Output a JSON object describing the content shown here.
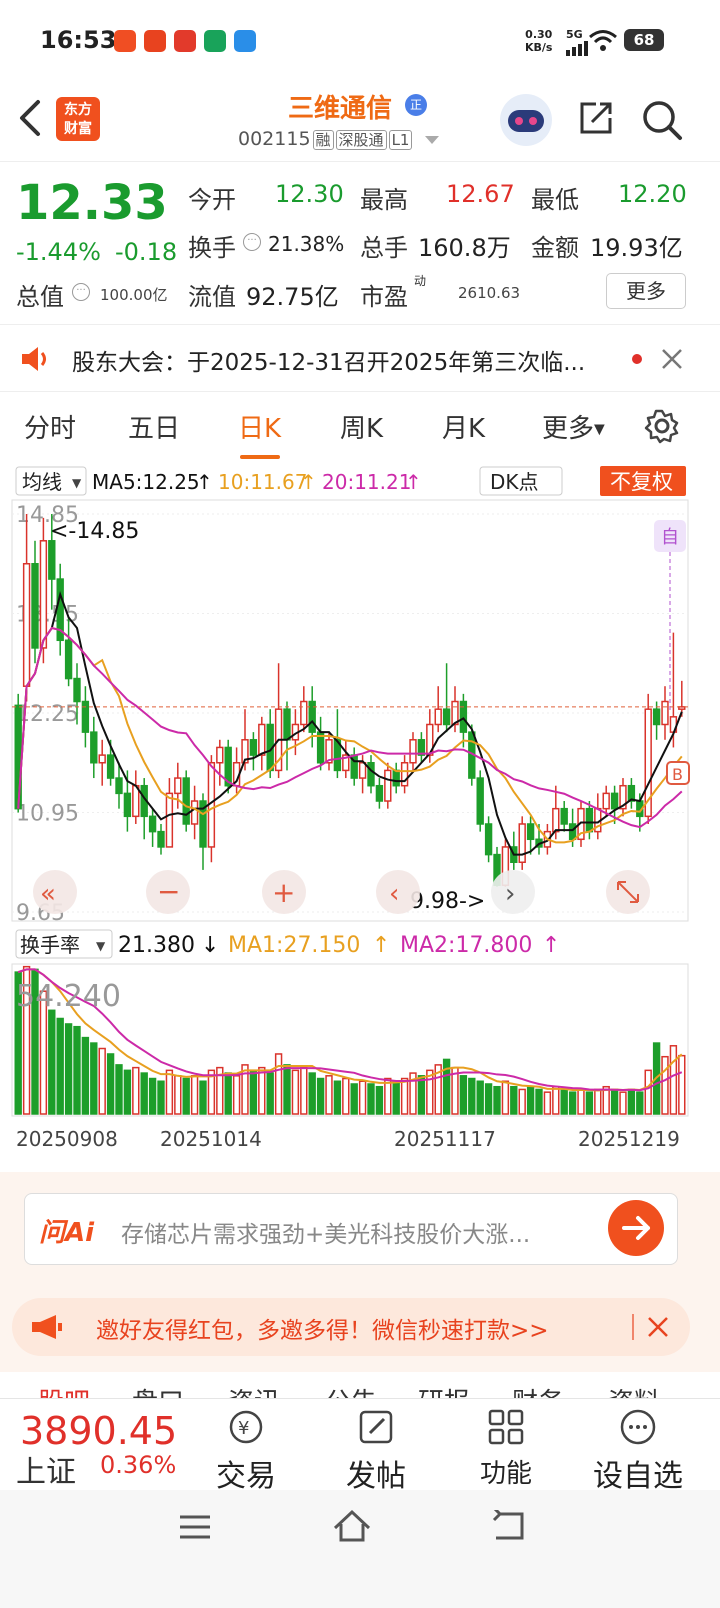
{
  "status": {
    "time": "16:53",
    "net_speed_value": "0.30",
    "net_speed_unit": "KB/s",
    "signal": "5G",
    "battery": "68",
    "app_badges": [
      "#f04e23",
      "#e8431f",
      "#e23a2b",
      "#19a35a",
      "#2a8ee8"
    ]
  },
  "header": {
    "logo_line1": "东方",
    "logo_line2": "财富",
    "stock_name": "三维通信",
    "zheng": "正",
    "code": "002115",
    "tag_rong": "融",
    "tag_sgt": "深股通",
    "tag_l1": "L1"
  },
  "quote": {
    "price": "12.33",
    "change_pct": "-1.44%",
    "change": "-0.18",
    "open_label": "今开",
    "open": "12.30",
    "high_label": "最高",
    "high": "12.67",
    "low_label": "最低",
    "low": "12.20",
    "turnover_label": "换手",
    "turnover": "21.38%",
    "volume_label": "总手",
    "volume": "160.8万",
    "amount_label": "金额",
    "amount": "19.93亿",
    "mktcap_label": "总值",
    "mktcap": "100.00亿",
    "float_label": "流值",
    "float": "92.75亿",
    "pe_label": "市盈",
    "pe_sup": "动",
    "pe": "2610.63",
    "more": "更多"
  },
  "notice": {
    "text": "股东大会：于2025-12-31召开2025年第三次临..."
  },
  "tabs": {
    "items": [
      "分时",
      "五日",
      "日K",
      "周K",
      "月K",
      "更多"
    ],
    "active": 2
  },
  "chart_data": {
    "type": "candlestick",
    "indicator_label": "均线",
    "ma5": "MA5:12.25",
    "ma10": "10:11.67",
    "ma20": "20:11.21",
    "dk_label": "DK点",
    "fq_label": "不复权",
    "y_ticks": [
      "14.85",
      "13.55",
      "12.25",
      "10.95",
      "9.65"
    ],
    "ylim": [
      9.65,
      14.85
    ],
    "high_marker": "<-14.85",
    "low_marker": "9.98->",
    "zi_marker": "自",
    "b_marker": "B",
    "colors": {
      "up": "#d9332b",
      "down": "#1d9e2a",
      "ma5": "#111111",
      "ma10": "#e8a020",
      "ma20": "#cc2aa8",
      "turnover": "#1d9e2a"
    },
    "candles": [
      [
        12.35,
        11.0,
        12.5,
        10.95
      ],
      [
        12.6,
        14.2,
        14.85,
        12.4
      ],
      [
        14.2,
        13.1,
        14.5,
        12.9
      ],
      [
        13.1,
        14.5,
        14.8,
        12.9
      ],
      [
        14.5,
        14.0,
        14.85,
        13.6
      ],
      [
        14.0,
        13.2,
        14.2,
        13.0
      ],
      [
        13.2,
        12.7,
        13.5,
        12.6
      ],
      [
        12.7,
        12.4,
        12.9,
        12.1
      ],
      [
        12.4,
        12.0,
        12.6,
        11.8
      ],
      [
        12.0,
        11.6,
        12.2,
        11.4
      ],
      [
        11.6,
        11.7,
        11.9,
        11.3
      ],
      [
        11.7,
        11.4,
        11.9,
        11.3
      ],
      [
        11.4,
        11.2,
        11.6,
        11.0
      ],
      [
        11.2,
        10.9,
        11.5,
        10.7
      ],
      [
        10.9,
        11.3,
        11.5,
        10.8
      ],
      [
        11.3,
        10.9,
        11.4,
        10.6
      ],
      [
        10.9,
        10.7,
        11.0,
        10.5
      ],
      [
        10.7,
        10.5,
        10.8,
        10.4
      ],
      [
        10.5,
        11.2,
        11.4,
        10.5
      ],
      [
        11.2,
        11.4,
        11.6,
        11.0
      ],
      [
        11.4,
        10.8,
        11.5,
        10.7
      ],
      [
        10.8,
        11.1,
        11.3,
        10.6
      ],
      [
        11.1,
        10.5,
        11.2,
        10.2
      ],
      [
        10.5,
        11.6,
        11.7,
        10.3
      ],
      [
        11.6,
        11.8,
        11.9,
        11.3
      ],
      [
        11.8,
        11.3,
        11.9,
        11.2
      ],
      [
        11.3,
        11.6,
        11.8,
        11.2
      ],
      [
        11.6,
        11.9,
        12.3,
        11.5
      ],
      [
        11.9,
        11.7,
        12.0,
        11.5
      ],
      [
        11.7,
        12.1,
        12.2,
        11.5
      ],
      [
        12.1,
        11.5,
        12.3,
        11.4
      ],
      [
        11.5,
        12.3,
        12.9,
        11.4
      ],
      [
        12.3,
        11.9,
        12.4,
        11.5
      ],
      [
        11.9,
        12.1,
        12.3,
        11.7
      ],
      [
        12.1,
        12.4,
        12.6,
        12.0
      ],
      [
        12.4,
        12.0,
        12.6,
        11.8
      ],
      [
        12.0,
        11.6,
        12.2,
        11.5
      ],
      [
        11.6,
        11.9,
        12.0,
        11.5
      ],
      [
        11.9,
        11.5,
        12.3,
        11.4
      ],
      [
        11.5,
        11.7,
        11.9,
        11.4
      ],
      [
        11.7,
        11.4,
        11.8,
        11.3
      ],
      [
        11.4,
        11.6,
        11.7,
        11.2
      ],
      [
        11.6,
        11.3,
        11.7,
        11.2
      ],
      [
        11.3,
        11.1,
        11.4,
        11.0
      ],
      [
        11.1,
        11.5,
        11.6,
        11.0
      ],
      [
        11.5,
        11.3,
        11.6,
        11.2
      ],
      [
        11.3,
        11.6,
        11.7,
        11.2
      ],
      [
        11.6,
        11.9,
        12.0,
        11.5
      ],
      [
        11.9,
        11.7,
        12.0,
        11.6
      ],
      [
        11.7,
        12.1,
        12.3,
        11.6
      ],
      [
        12.1,
        12.3,
        12.6,
        12.0
      ],
      [
        12.3,
        12.1,
        12.9,
        12.0
      ],
      [
        12.1,
        12.4,
        12.6,
        12.0
      ],
      [
        12.4,
        12.0,
        12.5,
        11.8
      ],
      [
        12.0,
        11.4,
        12.1,
        11.3
      ],
      [
        11.4,
        10.8,
        11.5,
        10.7
      ],
      [
        10.8,
        10.4,
        10.9,
        10.3
      ],
      [
        10.4,
        10.0,
        10.5,
        9.98
      ],
      [
        10.0,
        10.5,
        10.6,
        9.98
      ],
      [
        10.5,
        10.3,
        10.7,
        10.2
      ],
      [
        10.3,
        10.8,
        10.9,
        10.2
      ],
      [
        10.8,
        10.6,
        10.9,
        10.4
      ],
      [
        10.6,
        10.5,
        10.8,
        10.4
      ],
      [
        10.5,
        10.7,
        10.8,
        10.4
      ],
      [
        10.7,
        11.0,
        11.3,
        10.6
      ],
      [
        11.0,
        10.8,
        11.1,
        10.7
      ],
      [
        10.8,
        10.6,
        11.0,
        10.5
      ],
      [
        10.6,
        11.0,
        11.1,
        10.5
      ],
      [
        11.0,
        10.7,
        11.1,
        10.6
      ],
      [
        10.7,
        11.0,
        11.2,
        10.6
      ],
      [
        11.0,
        11.2,
        11.3,
        10.9
      ],
      [
        11.2,
        11.0,
        11.3,
        10.8
      ],
      [
        11.0,
        11.3,
        11.4,
        10.9
      ],
      [
        11.3,
        11.1,
        11.4,
        11.0
      ],
      [
        11.1,
        10.9,
        11.2,
        10.7
      ],
      [
        10.9,
        12.3,
        12.5,
        10.8
      ],
      [
        12.3,
        12.1,
        12.4,
        11.9
      ],
      [
        12.1,
        12.4,
        12.6,
        11.9
      ],
      [
        12.0,
        12.2,
        13.3,
        11.8
      ],
      [
        12.3,
        12.33,
        12.67,
        12.2
      ]
    ],
    "turnover_label": "换手率",
    "turnover_value": "21.380",
    "turnover_arrow": "↓",
    "ma1": "MA1:27.150",
    "ma2": "MA2:17.800",
    "turnover_top": "54.240",
    "turnover_values": [
      52,
      54,
      53,
      45,
      38,
      35,
      33,
      32,
      28,
      26,
      24,
      22,
      18,
      16,
      17,
      15,
      13,
      12,
      16,
      14,
      13,
      14,
      12,
      16,
      17,
      15,
      14,
      18,
      16,
      17,
      15,
      22,
      18,
      16,
      17,
      15,
      13,
      14,
      12,
      13,
      11,
      12,
      11,
      10,
      13,
      12,
      13,
      15,
      14,
      16,
      18,
      20,
      17,
      14,
      13,
      12,
      11,
      10,
      12,
      10,
      9,
      10,
      9,
      8,
      10,
      9,
      8,
      9,
      8,
      9,
      10,
      9,
      8,
      9,
      8,
      16,
      26,
      21,
      25,
      21.38
    ],
    "x_ticks": [
      "20250908",
      "20251014",
      "20251117",
      "20251219"
    ]
  },
  "ai": {
    "brand": "问Ai",
    "prompt": "存储芯片需求强劲+美光科技股价大涨..."
  },
  "invite": {
    "text": "邀好友得红包，多邀多得！微信秒速打款>>"
  },
  "news_tabs": [
    "股吧",
    "盘口",
    "资讯",
    "公告",
    "研报",
    "财务",
    "资料"
  ],
  "bottom": {
    "index_value": "3890.45",
    "index_name": "上证",
    "index_change": "0.36%",
    "trade": "交易",
    "post": "发帖",
    "func": "功能",
    "watch": "设自选"
  }
}
